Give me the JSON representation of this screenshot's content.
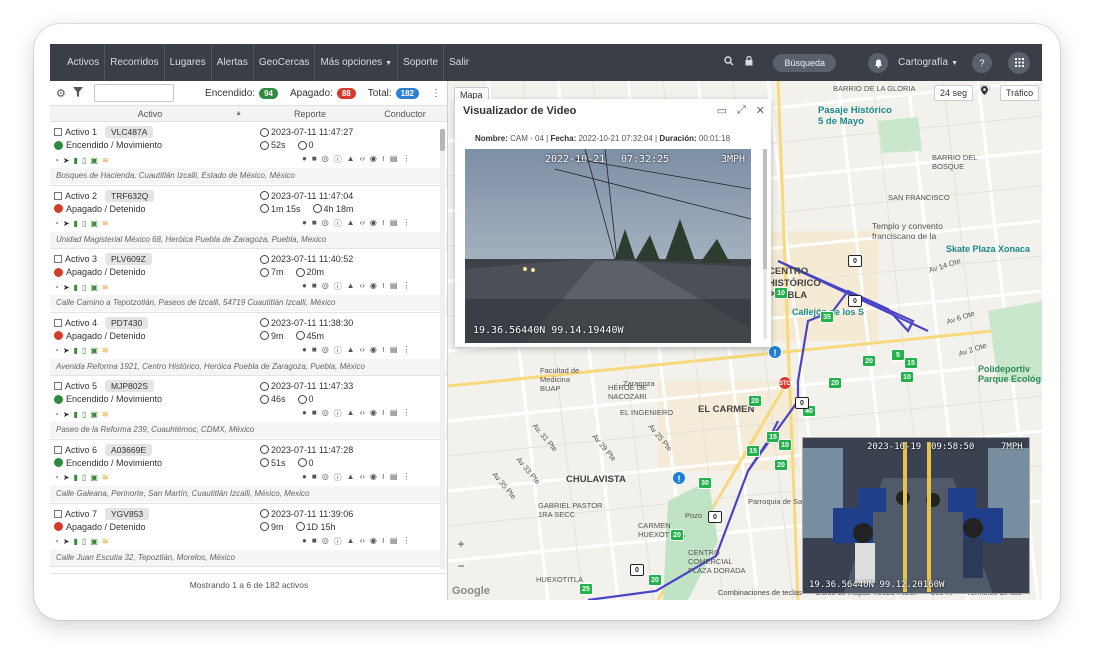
{
  "nav": {
    "items": [
      "Activos",
      "Recorridos",
      "Lugares",
      "Alertas",
      "GeoCercas",
      "Más opciones",
      "Soporte",
      "Salir"
    ],
    "search_button": "Búsqueda",
    "map_menu": "Cartografía"
  },
  "toolbar": {
    "on_label": "Encendido:",
    "on_count": "94",
    "off_label": "Apagado:",
    "off_count": "88",
    "total_label": "Total:",
    "total_count": "182",
    "colors": {
      "on": "#2e8b3e",
      "off": "#d43b2a",
      "total": "#2f7fd1"
    }
  },
  "table": {
    "headers": [
      "Activo",
      "Reporte",
      "Conductor"
    ],
    "rows": [
      {
        "name": "Activo 1",
        "plate": "VLC487A",
        "date": "2023-07-11 11:47:27",
        "status": "Encendido / Movimiento",
        "on": true,
        "t1": "52s",
        "t2": "0",
        "address": "Bosques de Hacienda, Cuautitlán Izcalli, Estado de México, México"
      },
      {
        "name": "Activo 2",
        "plate": "TRF632Q",
        "date": "2023-07-11 11:47:04",
        "status": "Apagado / Detenido",
        "on": false,
        "t1": "1m 15s",
        "t2": "4h 18m",
        "address": "Unidad Magisterial México 68, Heróica Puebla de Zaragoza, Puebla, Mexico"
      },
      {
        "name": "Activo 3",
        "plate": "PLV609Z",
        "date": "2023-07-11 11:40:52",
        "status": "Apagado / Detenido",
        "on": false,
        "t1": "7m",
        "t2": "20m",
        "address": "Calle Camino a Tepotzotlán, Paseos de Izcalli, 54719 Cuautitlán Izcalli, México"
      },
      {
        "name": "Activo 4",
        "plate": "PDT430",
        "date": "2023-07-11 11:38:30",
        "status": "Apagado / Detenido",
        "on": false,
        "t1": "9m",
        "t2": "45m",
        "address": "Avenida Reforma 1921, Centro Histórico, Heróica Puebla de Zaragoza, Puebla, México"
      },
      {
        "name": "Activo 5",
        "plate": "MJP802S",
        "date": "2023-07-11 11:47:33",
        "status": "Encendido / Movimiento",
        "on": true,
        "t1": "46s",
        "t2": "0",
        "address": "Paseo de la Reforma 239, Cuauhtémoc, CDMX, México"
      },
      {
        "name": "Activo 6",
        "plate": "A03669E",
        "date": "2023-07-11 11:47:28",
        "status": "Encendido / Movimiento",
        "on": true,
        "t1": "51s",
        "t2": "0",
        "address": "Calle Galeana, Perinorte, San Martín, Cuautitlán Izcalli, México, Mexico"
      },
      {
        "name": "Activo 7",
        "plate": "YGV853",
        "date": "2023-07-11 11:39:06",
        "status": "Apagado / Detenido",
        "on": false,
        "t1": "9m",
        "t2": "1D 15h",
        "address": "Calle Juan Escutia 32, Tepoztlán, Morelos, México"
      }
    ],
    "footer": "Mostrando 1 a 6 de 182 activos"
  },
  "map": {
    "refresh": "24 seg",
    "traffic": "Tráfico",
    "type_button": "Mapa",
    "labels": {
      "barrio_gloria": "BARRIO DE\nLA GLORIA",
      "pasaje": "Pasaje Histórico\n5 de Mayo",
      "barrio_bosque": "BARRIO DEL\nBOSQUE",
      "san_francisco": "SAN FRANCISCO",
      "templo": "Templo y convento\nfranciscano de la",
      "skate": "Skate Plaza Xonaca",
      "centro": "CENTRO\nHISTÓRICO\nPUEBLA",
      "callejon": "Callejón de los S",
      "zaragoza": "Zaragoza",
      "facultad": "Facultad de\nMedicina\nBUAP",
      "heroes": "HÉROE DE\nNACOZARI",
      "ingeniero": "EL INGENIERO",
      "el_carmen": "EL CARMEN",
      "chulavista": "CHULAVISTA",
      "gabriel": "GABRIEL PASTOR\n1RA SECC",
      "carmen_huexotitla": "CARMEN\nHUEXOTITLA",
      "parroquia": "Parroquia de San",
      "centro_comercial": "CENTRO\nCOMERCIAL\nPLAZA DORADA",
      "polideportivo": "Polideportiv\nParque Ecológ",
      "huexotitla": "HUEXOTITLA",
      "pozo": "Pozo",
      "av14": "Av 14 Ote",
      "av6": "Av 6 Ote",
      "av2": "Av 2 Ote",
      "av31": "Av. 31 Pte",
      "av25": "Av 25 Pte",
      "av29": "Av 29 Pte",
      "av33": "Av 33 Pte",
      "av35": "Av 35 Pte"
    },
    "footer": {
      "shortcuts": "Combinaciones de teclas",
      "data": "Datos de mapas ©2023 INEGI",
      "scale": "200 m",
      "terms": "Términos de uso"
    },
    "markers": [
      "10",
      "35",
      "20",
      "5",
      "15",
      "10",
      "20",
      "40",
      "20",
      "15",
      "15",
      "10",
      "20",
      "30",
      "20",
      "20",
      "20",
      "25"
    ],
    "stop_marker": "STOP"
  },
  "viewer": {
    "title": "Visualizador de Video",
    "name_label": "Nombre:",
    "name": "CAM - 04",
    "date_label": "Fecha:",
    "date": "2022-10-21 07:32:04",
    "dur_label": "Duración:",
    "dur": "00:01:18",
    "osd_date": "2022-10-21",
    "osd_time": "07:32:25",
    "osd_speed": "3MPH",
    "osd_coords": "19.36.56440N 99.14.19440W"
  },
  "cam2": {
    "osd_date": "2023-10-19",
    "osd_time": "09:58:50",
    "osd_speed": "7MPH",
    "osd_coords": "19.36.56440N 99.12.20160W"
  }
}
